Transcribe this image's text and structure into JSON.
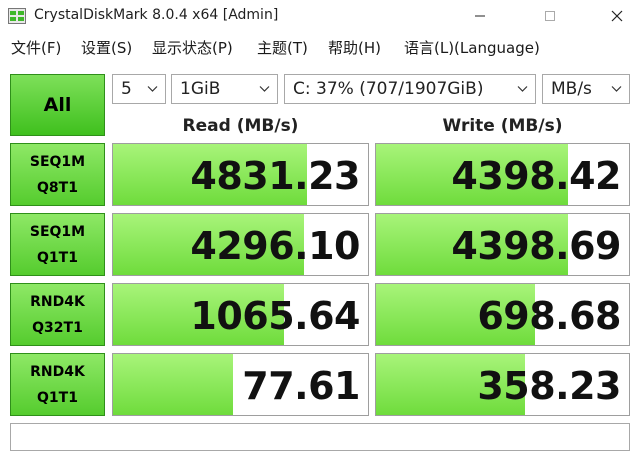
{
  "window": {
    "title": "CrystalDiskMark 8.0.4 x64 [Admin]"
  },
  "menu": [
    {
      "label": "文件(F)"
    },
    {
      "label": "设置(S)"
    },
    {
      "label": "显示状态(P)"
    },
    {
      "label": "主题(T)"
    },
    {
      "label": "帮助(H)"
    },
    {
      "label": "语言(L)(Language)"
    }
  ],
  "controls": {
    "all_label": "All",
    "count": "5",
    "size": "1GiB",
    "drive": "C: 37% (707/1907GiB)",
    "unit": "MB/s"
  },
  "columns": {
    "read": "Read (MB/s)",
    "write": "Write (MB/s)"
  },
  "rows": [
    {
      "line1": "SEQ1M",
      "line2": "Q8T1",
      "read": "4831.23",
      "write": "4398.42",
      "read_fill": 0.76,
      "write_fill": 0.76
    },
    {
      "line1": "SEQ1M",
      "line2": "Q1T1",
      "read": "4296.10",
      "write": "4398.69",
      "read_fill": 0.75,
      "write_fill": 0.76
    },
    {
      "line1": "RND4K",
      "line2": "Q32T1",
      "read": "1065.64",
      "write": "698.68",
      "read_fill": 0.67,
      "write_fill": 0.63
    },
    {
      "line1": "RND4K",
      "line2": "Q1T1",
      "read": "77.61",
      "write": "358.23",
      "read_fill": 0.47,
      "write_fill": 0.59
    }
  ],
  "status_text": "",
  "colors": {
    "accent_green": "#55cc2e",
    "bar_green": "#8ee866"
  }
}
